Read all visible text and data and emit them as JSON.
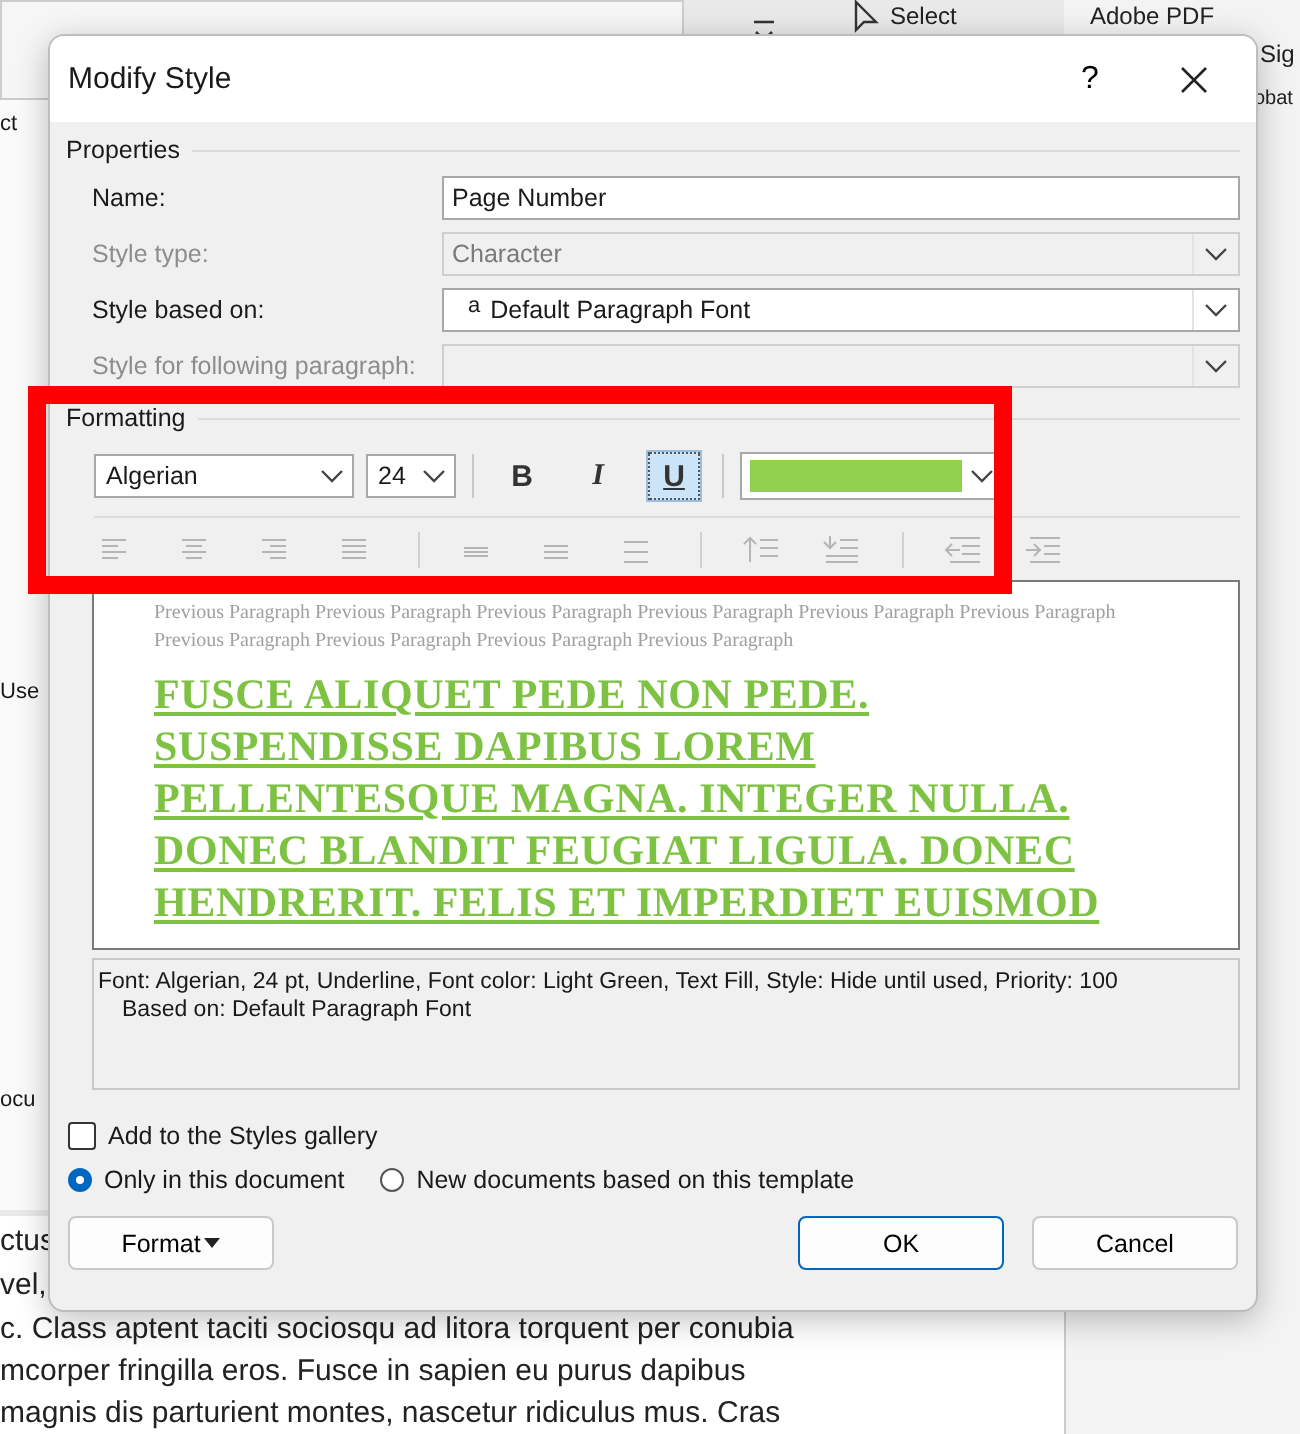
{
  "background": {
    "ribbon_texts": [
      "Adobe PDF",
      "Sig",
      "obat",
      "Select"
    ],
    "side_texts": [
      "ct",
      "Use",
      "ocu"
    ],
    "document_lines": [
      "ctus",
      "vel,",
      "c. Class aptent taciti sociosqu ad litora torquent per conubia",
      "mcorper fringilla eros. Fusce in sapien eu purus dapibus",
      "magnis dis parturient montes, nascetur ridiculus mus. Cras"
    ]
  },
  "window": {
    "title": "Modify Style",
    "help": "?"
  },
  "properties": {
    "heading": "Properties",
    "fields": [
      {
        "label": "Name:",
        "kind": "text",
        "value": "Page Number",
        "disabled": false
      },
      {
        "label": "Style type:",
        "kind": "dropdown",
        "value": "Character",
        "disabled": true
      },
      {
        "label": "Style based on:",
        "kind": "dropdown",
        "prefix": "a",
        "value": "Default Paragraph Font",
        "disabled": false
      },
      {
        "label": "Style for following paragraph:",
        "kind": "dropdown",
        "disabled": true
      }
    ]
  },
  "formatting": {
    "heading": "Formatting",
    "font": "Algerian",
    "size": "24",
    "buttons": [
      {
        "label": "B",
        "kind": "bold",
        "selected": false
      },
      {
        "label": "I",
        "kind": "italic",
        "selected": false
      },
      {
        "label": "U",
        "kind": "underline",
        "selected": true
      }
    ],
    "font_color": {
      "color": "#92d050"
    },
    "paragraph_toolbar": {
      "disabled": true
    }
  },
  "preview": {
    "previous": "Previous Paragraph Previous Paragraph Previous Paragraph Previous Paragraph Previous Paragraph Previous Paragraph Previous Paragraph Previous Paragraph Previous Paragraph Previous Paragraph",
    "sample": "FUSCE ALIQUET PEDE NON PEDE. SUSPENDISSE DAPIBUS LOREM PELLENTESQUE MAGNA. INTEGER NULLA. DONEC BLANDIT FEUGIAT LIGULA. DONEC HENDRERIT. FELIS ET IMPERDIET EUISMOD",
    "color": "#7dc242"
  },
  "description": [
    "Font: Algerian, 24 pt, Underline, Font color: Light Green, Text Fill, Style: Hide until used, Priority: 100",
    "Based on: Default Paragraph Font"
  ],
  "options": {
    "gallery": {
      "label": "Add to the Styles gallery",
      "checked": false
    },
    "scope": [
      {
        "label": "Only in this document",
        "selected": true
      },
      {
        "label": "New documents based on this template",
        "selected": false
      }
    ]
  },
  "buttons": {
    "format": "Format",
    "ok": "OK",
    "cancel": "Cancel"
  }
}
